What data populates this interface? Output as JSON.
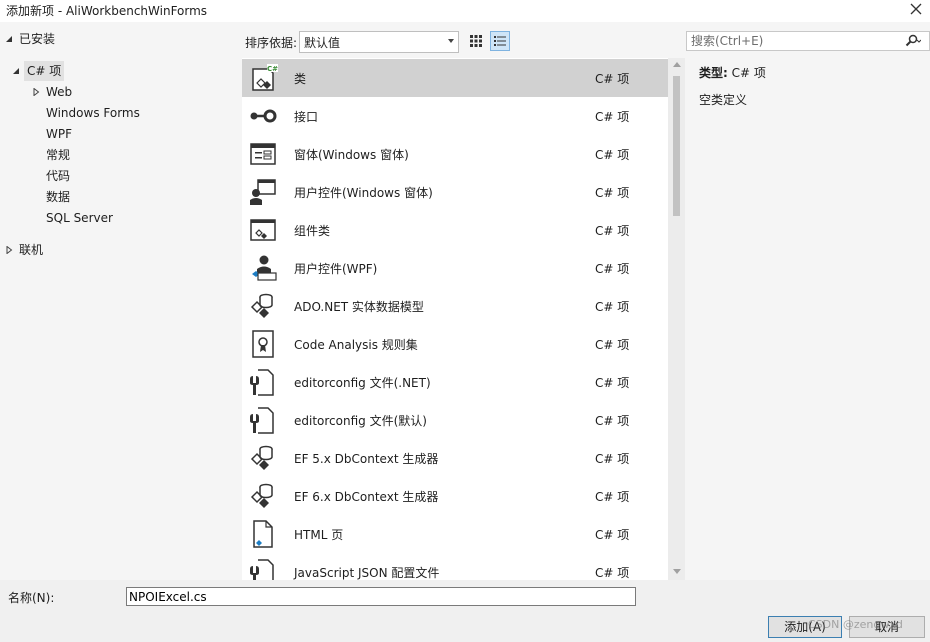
{
  "window": {
    "title": "添加新项 - AliWorkbenchWinForms"
  },
  "tree": {
    "installed": "已安装",
    "csharp": "C# 项",
    "children": [
      "Web",
      "Windows Forms",
      "WPF",
      "常规",
      "代码",
      "数据",
      "SQL Server"
    ],
    "online": "联机"
  },
  "sort": {
    "label": "排序依据:",
    "value": "默认值"
  },
  "search": {
    "placeholder": "搜索(Ctrl+E)"
  },
  "items": [
    {
      "name": "类",
      "lang": "C# 项",
      "icon": "class-icon"
    },
    {
      "name": "接口",
      "lang": "C# 项",
      "icon": "interface-icon"
    },
    {
      "name": "窗体(Windows 窗体)",
      "lang": "C# 项",
      "icon": "form-icon"
    },
    {
      "name": "用户控件(Windows 窗体)",
      "lang": "C# 项",
      "icon": "user-control-icon"
    },
    {
      "name": "组件类",
      "lang": "C# 项",
      "icon": "component-class-icon"
    },
    {
      "name": "用户控件(WPF)",
      "lang": "C# 项",
      "icon": "wpf-user-control-icon"
    },
    {
      "name": "ADO.NET 实体数据模型",
      "lang": "C# 项",
      "icon": "data-model-icon"
    },
    {
      "name": "Code Analysis 规则集",
      "lang": "C# 项",
      "icon": "ruleset-icon"
    },
    {
      "name": "editorconfig 文件(.NET)",
      "lang": "C# 项",
      "icon": "config-file-icon"
    },
    {
      "name": "editorconfig 文件(默认)",
      "lang": "C# 项",
      "icon": "config-file-icon"
    },
    {
      "name": "EF 5.x DbContext 生成器",
      "lang": "C# 项",
      "icon": "data-model-icon"
    },
    {
      "name": "EF 6.x DbContext 生成器",
      "lang": "C# 项",
      "icon": "data-model-icon"
    },
    {
      "name": "HTML 页",
      "lang": "C# 项",
      "icon": "html-page-icon"
    },
    {
      "name": "JavaScript JSON 配置文件",
      "lang": "C# 项",
      "icon": "config-file-icon"
    }
  ],
  "details": {
    "type_label": "类型:",
    "type_value": "C# 项",
    "description": "空类定义"
  },
  "footer": {
    "name_label": "名称(N):",
    "name_value": "NPOIExcel.cs",
    "add_label": "添加(A)",
    "cancel_label": "取消",
    "watermark": "CSDN @zengwxd"
  }
}
